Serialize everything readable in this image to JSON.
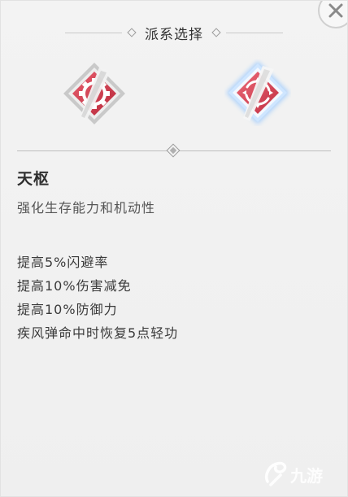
{
  "header": {
    "title": "派系选择"
  },
  "factions": [
    {
      "icon": "gear-slash-emblem-icon",
      "selected": false
    },
    {
      "icon": "compass-slash-emblem-icon",
      "selected": true
    }
  ],
  "selected_faction": {
    "name": "天枢",
    "description": "强化生存能力和机动性",
    "bonuses": [
      "提高5%闪避率",
      "提高10%伤害减免",
      "提高10%防御力",
      "疾风弹命中时恢复5点轻功"
    ]
  },
  "watermark": {
    "text": "九游"
  },
  "colors": {
    "emblem_red": "#d9414f",
    "selected_glow": "#8fc4ff",
    "panel_bg": "#f0f0f0"
  }
}
